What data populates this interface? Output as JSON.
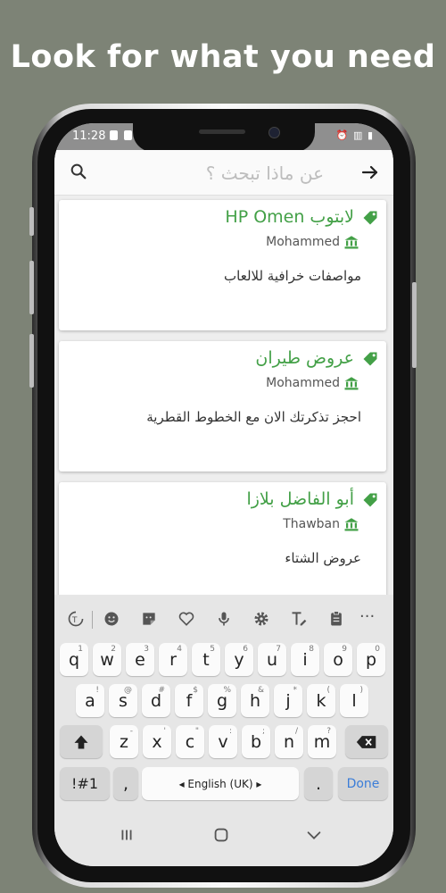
{
  "headline": "Look for what you need",
  "status": {
    "time": "11:28"
  },
  "search": {
    "placeholder": "عن ماذا تبحث ؟"
  },
  "cards": [
    {
      "title": "لابتوب HP Omen",
      "author": "Mohammed",
      "description": "مواصفات خرافية للالعاب"
    },
    {
      "title": "عروض طيران",
      "author": "Mohammed",
      "description": "احجز تذكرتك الان مع الخطوط القطرية"
    },
    {
      "title": "أبو الفاضل بلازا",
      "author": "Thawban",
      "description": "عروض الشتاء"
    }
  ],
  "keyboard": {
    "row1": [
      {
        "k": "q",
        "s": "1"
      },
      {
        "k": "w",
        "s": "2"
      },
      {
        "k": "e",
        "s": "3"
      },
      {
        "k": "r",
        "s": "4"
      },
      {
        "k": "t",
        "s": "5"
      },
      {
        "k": "y",
        "s": "6"
      },
      {
        "k": "u",
        "s": "7"
      },
      {
        "k": "i",
        "s": "8"
      },
      {
        "k": "o",
        "s": "9"
      },
      {
        "k": "p",
        "s": "0"
      }
    ],
    "row2": [
      {
        "k": "a",
        "s": "!"
      },
      {
        "k": "s",
        "s": "@"
      },
      {
        "k": "d",
        "s": "#"
      },
      {
        "k": "f",
        "s": "$"
      },
      {
        "k": "g",
        "s": "%"
      },
      {
        "k": "h",
        "s": "&"
      },
      {
        "k": "j",
        "s": "*"
      },
      {
        "k": "k",
        "s": "("
      },
      {
        "k": "l",
        "s": ")"
      }
    ],
    "row3": [
      {
        "k": "z",
        "s": "-"
      },
      {
        "k": "x",
        "s": "'"
      },
      {
        "k": "c",
        "s": "\""
      },
      {
        "k": "v",
        "s": ":"
      },
      {
        "k": "b",
        "s": ";"
      },
      {
        "k": "n",
        "s": "/"
      },
      {
        "k": "m",
        "s": "?"
      }
    ],
    "symbols_label": "!#1",
    "comma": ",",
    "space_label": "◂ English (UK) ▸",
    "period": ".",
    "done_label": "Done"
  },
  "colors": {
    "accent_green": "#43a047",
    "done_blue": "#3b7dd8"
  }
}
